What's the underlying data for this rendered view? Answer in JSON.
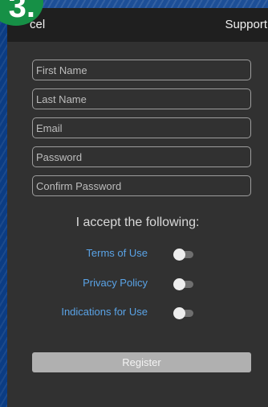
{
  "badge": {
    "label": "3."
  },
  "topbar": {
    "cancel_label": "cel",
    "support_label": "Support"
  },
  "form": {
    "first_name": {
      "placeholder": "First Name",
      "value": ""
    },
    "last_name": {
      "placeholder": "Last Name",
      "value": ""
    },
    "email": {
      "placeholder": "Email",
      "value": ""
    },
    "password": {
      "placeholder": "Password",
      "value": ""
    },
    "confirm_password": {
      "placeholder": "Confirm Password",
      "value": ""
    }
  },
  "agreements": {
    "heading": "I accept the following:",
    "items": [
      {
        "label": "Terms of Use",
        "checked": false
      },
      {
        "label": "Privacy Policy",
        "checked": false
      },
      {
        "label": "Indications for Use",
        "checked": false
      }
    ]
  },
  "register": {
    "label": "Register",
    "enabled": false
  },
  "colors": {
    "link": "#5aa3e6",
    "background": "#313131",
    "topbar": "#1f1f1f",
    "badge": "#169046",
    "frame": "#0b3c83"
  }
}
